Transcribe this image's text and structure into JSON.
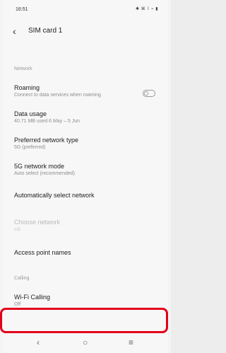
{
  "status_bar": {
    "time": "16:51",
    "icons_text": "✱ ⌘ ⌇ ⌁ ▮"
  },
  "header": {
    "title": "SIM card 1"
  },
  "sections": {
    "network": "Network",
    "calling": "Calling"
  },
  "items": {
    "roaming": {
      "title": "Roaming",
      "subtitle": "Connect to data services when roaming",
      "toggle_on": false
    },
    "data_usage": {
      "title": "Data usage",
      "subtitle": "40.71 MB used 6 May – 5 Jun"
    },
    "preferred_network_type": {
      "title": "Preferred network type",
      "subtitle": "5G (preferred)"
    },
    "five_g_mode": {
      "title": "5G network mode",
      "subtitle": "Auto select (recommended)"
    },
    "auto_select": {
      "title": "Automatically select network"
    },
    "choose_network": {
      "title": "Choose network",
      "subtitle": "csl."
    },
    "apn": {
      "title": "Access point names"
    },
    "wifi_calling": {
      "title": "Wi-Fi Calling",
      "subtitle": "Off"
    }
  },
  "nav": {
    "back_icon": "back-icon",
    "home_icon": "home-icon",
    "menu_icon": "menu-icon"
  }
}
